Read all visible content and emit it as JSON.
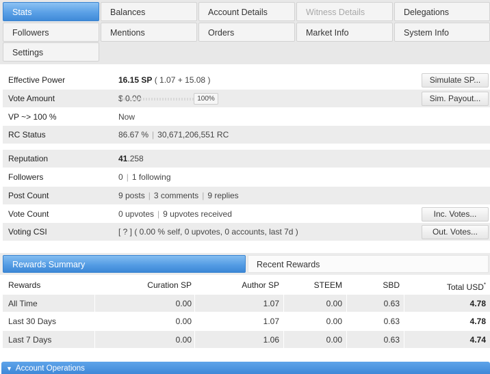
{
  "tabs": [
    {
      "label": "Stats",
      "state": "active"
    },
    {
      "label": "Balances",
      "state": "normal"
    },
    {
      "label": "Account Details",
      "state": "normal"
    },
    {
      "label": "Witness Details",
      "state": "disabled"
    },
    {
      "label": "Delegations",
      "state": "normal"
    },
    {
      "label": "Followers",
      "state": "normal"
    },
    {
      "label": "Mentions",
      "state": "normal"
    },
    {
      "label": "Orders",
      "state": "normal"
    },
    {
      "label": "Market Info",
      "state": "normal"
    },
    {
      "label": "System Info",
      "state": "normal"
    },
    {
      "label": "Settings",
      "state": "normal"
    }
  ],
  "stats": {
    "effective_power": {
      "label": "Effective Power",
      "value": "16.15 SP",
      "detail": "( 1.07 + 15.08 )",
      "button": "Simulate SP..."
    },
    "vote_amount": {
      "label": "Vote Amount",
      "value": "$ 0.00",
      "slider_value": "100%",
      "button": "Sim. Payout..."
    },
    "vp": {
      "label": "VP ~> 100 %",
      "value": "Now"
    },
    "rc_status": {
      "label": "RC Status",
      "percent": "86.67 %",
      "rc": "30,671,206,551 RC"
    },
    "reputation": {
      "label": "Reputation",
      "value_int": "41",
      "value_dec": ".258"
    },
    "followers": {
      "label": "Followers",
      "followers": "0",
      "following": "1 following"
    },
    "post_count": {
      "label": "Post Count",
      "posts": "9 posts",
      "comments": "3 comments",
      "replies": "9 replies"
    },
    "vote_count": {
      "label": "Vote Count",
      "upvotes": "0 upvotes",
      "received": "9 upvotes received",
      "button": "Inc. Votes..."
    },
    "voting_csi": {
      "label": "Voting CSI",
      "value": "[ ? ] ( 0.00 % self, 0 upvotes, 0 accounts, last 7d )",
      "button": "Out. Votes..."
    }
  },
  "rewards_tabs": {
    "active": "Rewards Summary",
    "inactive": "Recent Rewards"
  },
  "rewards": {
    "headers": [
      "Rewards",
      "Curation SP",
      "Author SP",
      "STEEM",
      "SBD",
      "Total USD"
    ],
    "header_footnote": "*",
    "rows": [
      [
        "All Time",
        "0.00",
        "1.07",
        "0.00",
        "0.63",
        "4.78"
      ],
      [
        "Last 30 Days",
        "0.00",
        "1.07",
        "0.00",
        "0.63",
        "4.78"
      ],
      [
        "Last 7 Days",
        "0.00",
        "1.06",
        "0.00",
        "0.63",
        "4.74"
      ]
    ]
  },
  "operations_bar": {
    "label": "Account Operations",
    "icon": "chevron-down-icon"
  }
}
